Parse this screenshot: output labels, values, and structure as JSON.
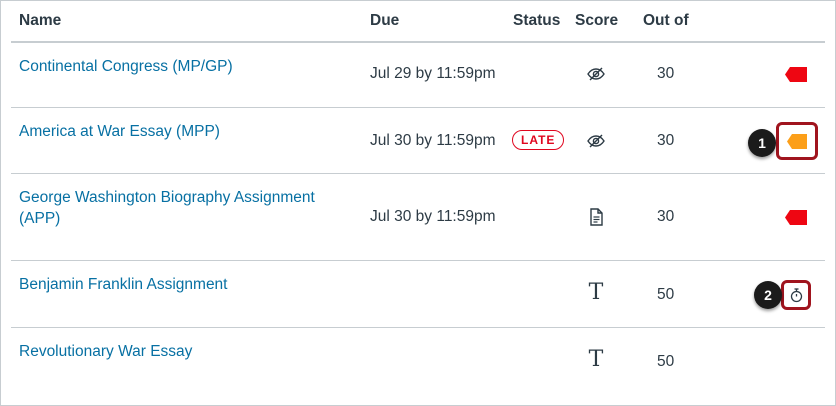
{
  "columns": {
    "name": "Name",
    "due": "Due",
    "status": "Status",
    "score": "Score",
    "out_of": "Out of"
  },
  "rows": [
    {
      "name": "Continental Congress (MP/GP)",
      "due": "Jul 29 by 11:59pm",
      "status": "",
      "score_icon": "eye-off-icon",
      "out_of": "30",
      "flag_icon": "red-tag-icon",
      "flag_color": "#ee0612"
    },
    {
      "name": "America at War Essay (MPP)",
      "due": "Jul 30 by 11:59pm",
      "status": "LATE",
      "score_icon": "eye-off-icon",
      "out_of": "30",
      "flag_icon": "orange-tag-icon",
      "flag_color": "#fc9f19",
      "callout": "1"
    },
    {
      "name": "George Washington Biography Assignment (APP)",
      "due": "Jul 30 by 11:59pm",
      "status": "",
      "score_icon": "document-icon",
      "out_of": "30",
      "flag_icon": "red-tag-icon",
      "flag_color": "#ee0612"
    },
    {
      "name": "Benjamin Franklin Assignment",
      "due": "",
      "status": "",
      "score_icon": "text-entry-icon",
      "score_glyph": "T",
      "out_of": "50",
      "flag_icon": "stopwatch-icon",
      "callout": "2"
    },
    {
      "name": "Revolutionary War Essay",
      "due": "",
      "status": "",
      "score_icon": "text-entry-icon",
      "score_glyph": "T",
      "out_of": "50"
    }
  ],
  "colors": {
    "link": "#0770a3",
    "late": "#e0061f",
    "callout_border": "#a0141e"
  }
}
